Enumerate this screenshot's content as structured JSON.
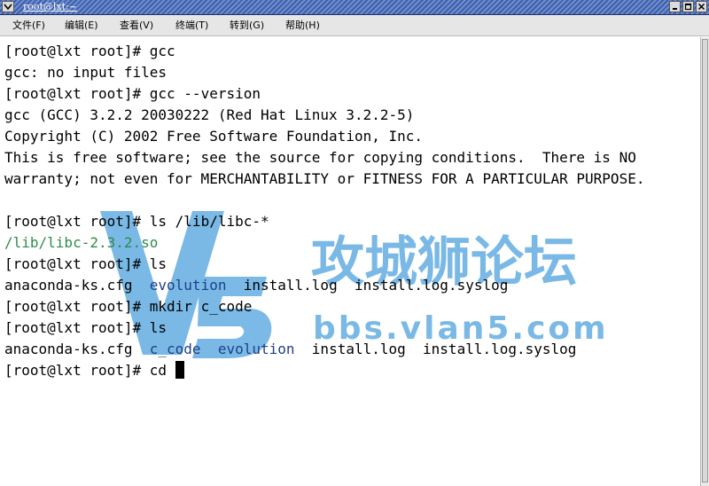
{
  "window": {
    "title": "root@lxt:~"
  },
  "menu": [
    "文件(F)",
    "编辑(E)",
    "查看(V)",
    "终端(T)",
    "转到(G)",
    "帮助(H)"
  ],
  "lines": [
    {
      "prompt": "[root@lxt root]# ",
      "cmd": "gcc"
    },
    {
      "text": "gcc: no input files"
    },
    {
      "prompt": "[root@lxt root]# ",
      "cmd": "gcc --version"
    },
    {
      "text": "gcc (GCC) 3.2.2 20030222 (Red Hat Linux 3.2.2-5)"
    },
    {
      "text": "Copyright (C) 2002 Free Software Foundation, Inc."
    },
    {
      "text": "This is free software; see the source for copying conditions.  There is NO"
    },
    {
      "text": "warranty; not even for MERCHANTABILITY or FITNESS FOR A PARTICULAR PURPOSE."
    },
    {
      "text": ""
    },
    {
      "prompt": "[root@lxt root]# ",
      "cmd": "ls /lib/libc-*"
    },
    {
      "green": "/lib/libc-2.3.2.so"
    },
    {
      "prompt": "[root@lxt root]# ",
      "cmd": "ls"
    },
    {
      "files": [
        {
          "name": "anaconda-ks.cfg",
          "dir": false
        },
        {
          "name": "evolution",
          "dir": true
        },
        {
          "name": "install.log",
          "dir": false
        },
        {
          "name": "install.log.syslog",
          "dir": false
        }
      ]
    },
    {
      "prompt": "[root@lxt root]# ",
      "cmd": "mkdir c_code"
    },
    {
      "prompt": "[root@lxt root]# ",
      "cmd": "ls"
    },
    {
      "files": [
        {
          "name": "anaconda-ks.cfg",
          "dir": false
        },
        {
          "name": "c_code",
          "dir": true
        },
        {
          "name": "evolution",
          "dir": true
        },
        {
          "name": "install.log",
          "dir": false
        },
        {
          "name": "install.log.syslog",
          "dir": false
        }
      ]
    },
    {
      "prompt": "[root@lxt root]# ",
      "cmd": "cd ",
      "cursor": true
    }
  ],
  "watermark": {
    "name": "攻城狮论坛",
    "url": "bbs.vlan5.com",
    "color": "#5aa8e0"
  }
}
